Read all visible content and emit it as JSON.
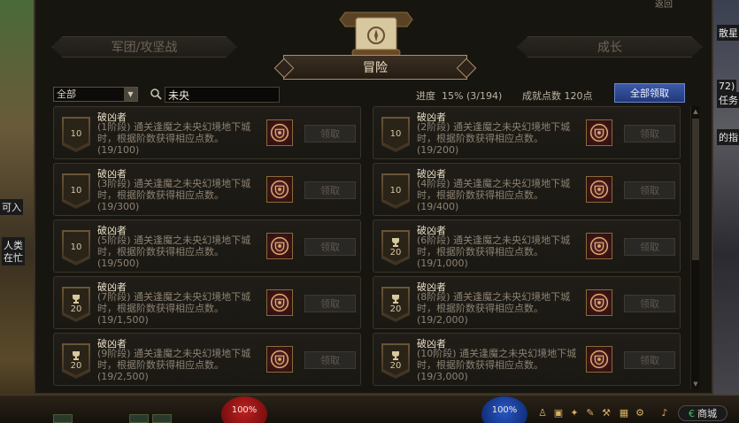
{
  "window": {
    "back_label": "返回",
    "tabs": {
      "left": "军团/攻坚战",
      "center": "冒险",
      "right": "成长"
    }
  },
  "filter": {
    "category_selected": "全部",
    "search_value": "未央",
    "progress_label": "进度",
    "progress_value": "15% (3/194)",
    "points_label": "成就点数",
    "points_value": "120点",
    "claim_all_label": "全部领取"
  },
  "cards": [
    {
      "title": "破凶者",
      "desc": "(1阶段) 通关逢魔之未央幻境地下城时，根据阶数获得相应点数。",
      "progress": "(19/100)",
      "points": "10",
      "trophy": false,
      "claim": "领取"
    },
    {
      "title": "破凶者",
      "desc": "(2阶段) 通关逢魔之未央幻境地下城时，根据阶数获得相应点数。",
      "progress": "(19/200)",
      "points": "10",
      "trophy": false,
      "claim": "领取"
    },
    {
      "title": "破凶者",
      "desc": "(3阶段) 通关逢魔之未央幻境地下城时，根据阶数获得相应点数。",
      "progress": "(19/300)",
      "points": "10",
      "trophy": false,
      "claim": "领取"
    },
    {
      "title": "破凶者",
      "desc": "(4阶段) 通关逢魔之未央幻境地下城时，根据阶数获得相应点数。",
      "progress": "(19/400)",
      "points": "10",
      "trophy": false,
      "claim": "领取"
    },
    {
      "title": "破凶者",
      "desc": "(5阶段) 通关逢魔之未央幻境地下城时，根据阶数获得相应点数。",
      "progress": "(19/500)",
      "points": "10",
      "trophy": false,
      "claim": "领取"
    },
    {
      "title": "破凶者",
      "desc": "(6阶段) 通关逢魔之未央幻境地下城时，根据阶数获得相应点数。",
      "progress": "(19/1,000)",
      "points": "20",
      "trophy": true,
      "claim": "领取"
    },
    {
      "title": "破凶者",
      "desc": "(7阶段) 通关逢魔之未央幻境地下城时，根据阶数获得相应点数。",
      "progress": "(19/1,500)",
      "points": "20",
      "trophy": true,
      "claim": "领取"
    },
    {
      "title": "破凶者",
      "desc": "(8阶段) 通关逢魔之未央幻境地下城时，根据阶数获得相应点数。",
      "progress": "(19/2,000)",
      "points": "20",
      "trophy": true,
      "claim": "领取"
    },
    {
      "title": "破凶者",
      "desc": "(9阶段) 通关逢魔之未央幻境地下城时，根据阶数获得相应点数。",
      "progress": "(19/2,500)",
      "points": "20",
      "trophy": true,
      "claim": "领取"
    },
    {
      "title": "破凶者",
      "desc": "(10阶段) 通关逢魔之未央幻境地下城时，根据阶数获得相应点数。",
      "progress": "(19/3,000)",
      "points": "20",
      "trophy": true,
      "claim": "领取"
    }
  ],
  "side": {
    "right_top": "散星",
    "right_mid1": "72)",
    "right_mid2": "任务",
    "right_mid3": "的指",
    "left_1": "可入",
    "left_2": "人类",
    "left_3": "在忙"
  },
  "hud": {
    "hp": "100%",
    "mp": "100%",
    "mall_label": "商城"
  },
  "colors": {
    "accent_blue": "#3c5aa8",
    "frame_gold": "#a8906a",
    "hp_red": "#c02020",
    "mp_blue": "#2858c8"
  }
}
